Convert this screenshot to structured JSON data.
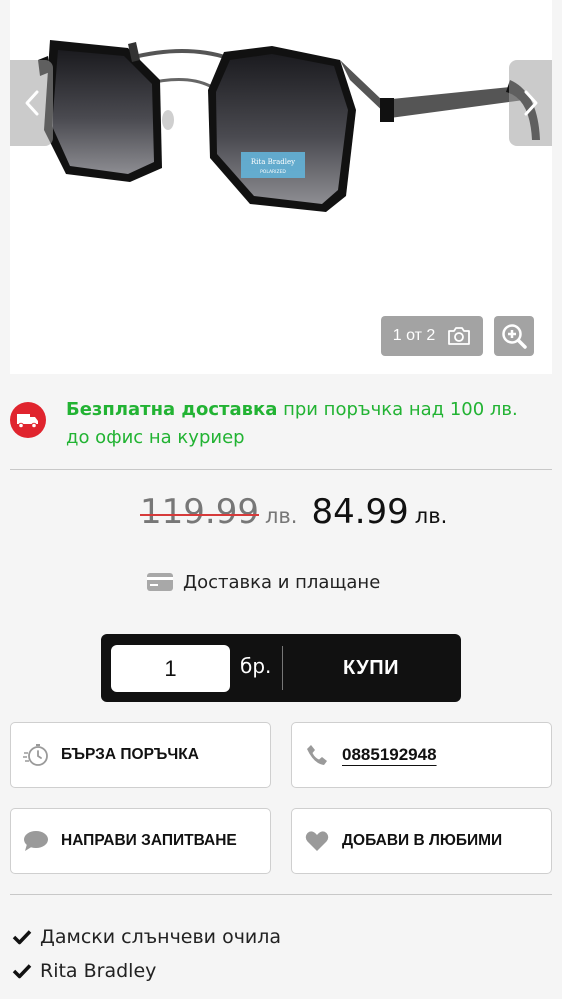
{
  "gallery": {
    "counter_text": "1 от 2",
    "prev_icon": "chevron-left-icon",
    "next_icon": "chevron-right-icon",
    "camera_icon": "camera-icon",
    "zoom_icon": "zoom-in-icon",
    "tag_brand": "Rita Bradley",
    "tag_sub": "POLARIZED"
  },
  "delivery": {
    "icon": "truck-icon",
    "bold_text": "Безплатна доставка",
    "rest_text": " при поръчка над 100 лв. до офис на куриер",
    "color": "#22b333"
  },
  "price": {
    "old_value": "119.99",
    "old_currency": "лв.",
    "new_value": "84.99",
    "new_currency": "лв."
  },
  "shipping_link": {
    "icon": "credit-card-icon",
    "label": "Доставка и плащане"
  },
  "buy": {
    "quantity": "1",
    "unit": "бр.",
    "button_label": "КУПИ"
  },
  "actions": {
    "quick_order": {
      "icon": "stopwatch-icon",
      "label": "БЪРЗА ПОРЪЧКА"
    },
    "phone": {
      "icon": "phone-icon",
      "label": "0885192948"
    },
    "ask": {
      "icon": "chat-bubble-icon",
      "label": "НАПРАВИ ЗАПИТВАНЕ"
    },
    "favorite": {
      "icon": "heart-icon",
      "label": "ДОБАВИ В ЛЮБИМИ"
    }
  },
  "features": [
    {
      "icon": "check-icon",
      "text": "Дамски слънчеви очила"
    },
    {
      "icon": "check-icon",
      "text": "Rita Bradley"
    }
  ]
}
